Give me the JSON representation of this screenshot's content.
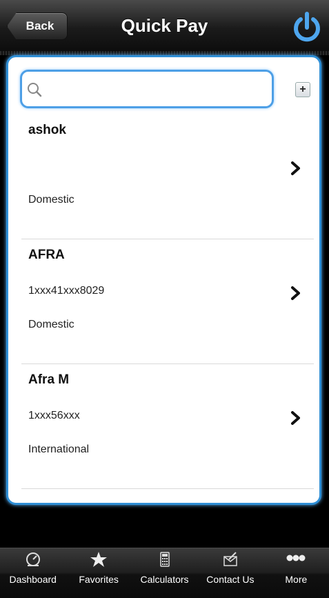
{
  "header": {
    "title": "Quick Pay",
    "back_label": "Back"
  },
  "search": {
    "placeholder": "",
    "value": ""
  },
  "add_label": "+",
  "payees": [
    {
      "name": "ashok",
      "account": "",
      "type": "Domestic"
    },
    {
      "name": "AFRA",
      "account": "1xxx41xxx8029",
      "type": "Domestic"
    },
    {
      "name": "Afra M",
      "account": "1xxx56xxx",
      "type": "International"
    }
  ],
  "tabs": [
    {
      "label": "Dashboard",
      "icon": "dashboard-icon"
    },
    {
      "label": "Favorites",
      "icon": "star-icon"
    },
    {
      "label": "Calculators",
      "icon": "calculator-icon"
    },
    {
      "label": "Contact Us",
      "icon": "contact-icon"
    },
    {
      "label": "More",
      "icon": "more-icon"
    }
  ],
  "colors": {
    "accent": "#2f8fd6",
    "power_icon": "#4ea6ee"
  }
}
